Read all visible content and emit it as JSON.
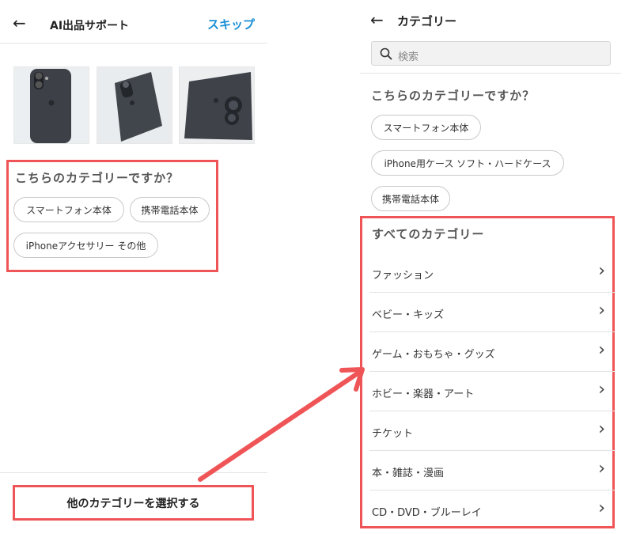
{
  "left": {
    "header": {
      "title": "AI出品サポート",
      "skip_label": "スキップ"
    },
    "photos": [
      "iphone-back-photo",
      "iphone-angled-photo",
      "iphone-camera-closeup-photo"
    ],
    "suggest": {
      "title": "こちらのカテゴリーですか？",
      "chips": [
        "スマートフォン本体",
        "携帯電話本体",
        "iPhoneアクセサリー その他"
      ]
    },
    "bottom_button": "他のカテゴリーを選択する"
  },
  "right": {
    "header": {
      "title": "カテゴリー"
    },
    "search": {
      "placeholder": "検索"
    },
    "suggest": {
      "title": "こちらのカテゴリーですか？",
      "chips": [
        "スマートフォン本体",
        "iPhone用ケース ソフト・ハードケース",
        "携帯電話本体"
      ]
    },
    "all": {
      "title": "すべてのカテゴリー",
      "items": [
        "ファッション",
        "ベビー・キッズ",
        "ゲーム・おもちゃ・グッズ",
        "ホビー・楽器・アート",
        "チケット",
        "本・雑誌・漫画",
        "CD・DVD・ブルーレイ"
      ]
    }
  },
  "colors": {
    "accent": "#1a8fd6",
    "highlight": "#ef5557"
  }
}
